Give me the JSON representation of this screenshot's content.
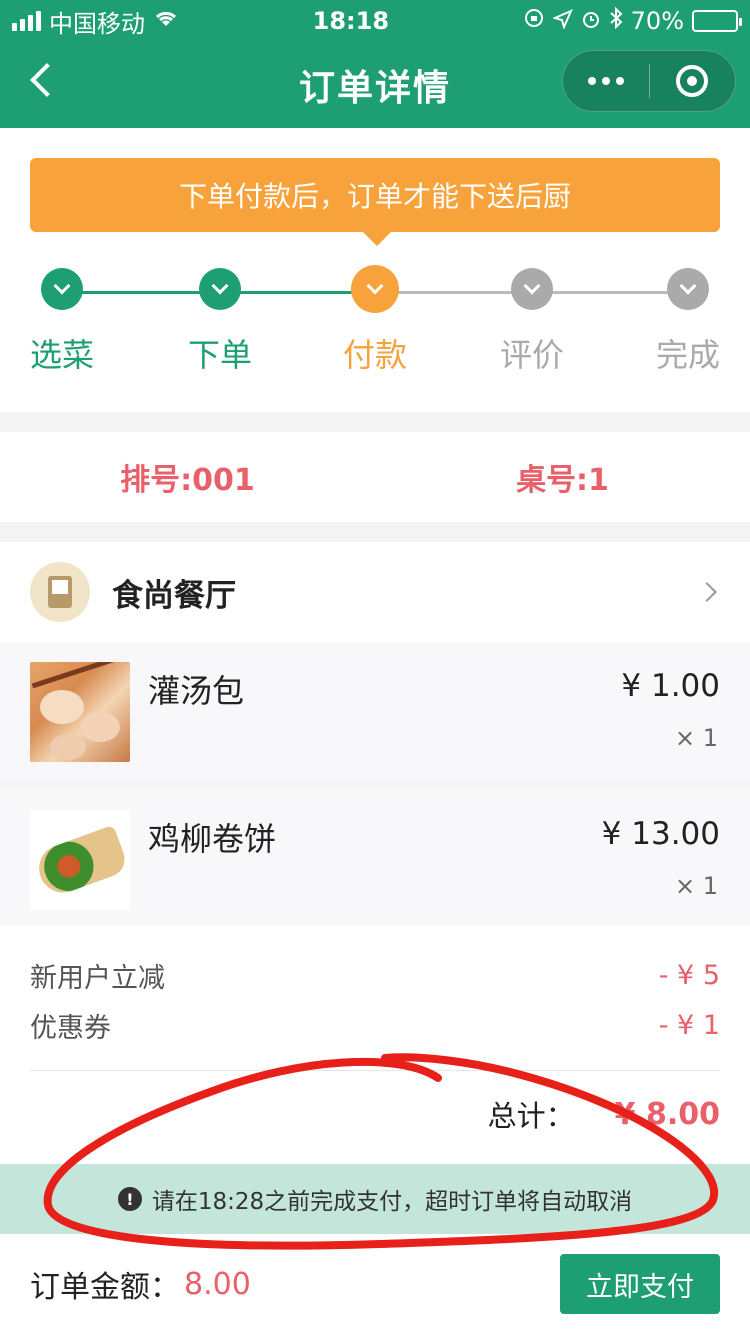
{
  "status_bar": {
    "carrier": "中国移动",
    "time": "18:18",
    "battery": "70%",
    "battery_level": 0.7,
    "icons": [
      "signal-icon",
      "wifi-icon",
      "lock-rotation-icon",
      "location-icon",
      "alarm-icon",
      "bluetooth-icon",
      "battery-icon"
    ]
  },
  "nav": {
    "title": "订单详情",
    "icons": [
      "back-icon",
      "more-icon",
      "close-target-icon"
    ]
  },
  "tip": {
    "text": "下单付款后，订单才能下送后厨"
  },
  "steps": [
    {
      "label": "选菜",
      "state": "done"
    },
    {
      "label": "下单",
      "state": "done"
    },
    {
      "label": "付款",
      "state": "current"
    },
    {
      "label": "评价",
      "state": "todo"
    },
    {
      "label": "完成",
      "state": "todo"
    }
  ],
  "queue": {
    "number": "排号:001",
    "table": "桌号:1"
  },
  "restaurant": {
    "name": "食尚餐厅"
  },
  "items": [
    {
      "name": "灌汤包",
      "price": "¥ 1.00",
      "qty": "× 1",
      "image": "soup-dumpling-photo"
    },
    {
      "name": "鸡柳卷饼",
      "price": "¥ 13.00",
      "qty": "× 1",
      "image": "chicken-wrap-photo"
    }
  ],
  "discounts": [
    {
      "label": "新用户立减",
      "amount": "- ¥ 5"
    },
    {
      "label": "优惠券",
      "amount": "- ¥ 1"
    }
  ],
  "total": {
    "label": "总计：",
    "amount": "¥ 8.00"
  },
  "notice": {
    "text": "请在18:28之前完成支付，超时订单将自动取消"
  },
  "bottom": {
    "label": "订单金额：",
    "amount": "8.00",
    "pay_button": "立即支付"
  },
  "colors": {
    "brand": "#1e9e73",
    "accent": "#f7a23b",
    "price": "#e8606a",
    "annotation": "#e8201a"
  }
}
